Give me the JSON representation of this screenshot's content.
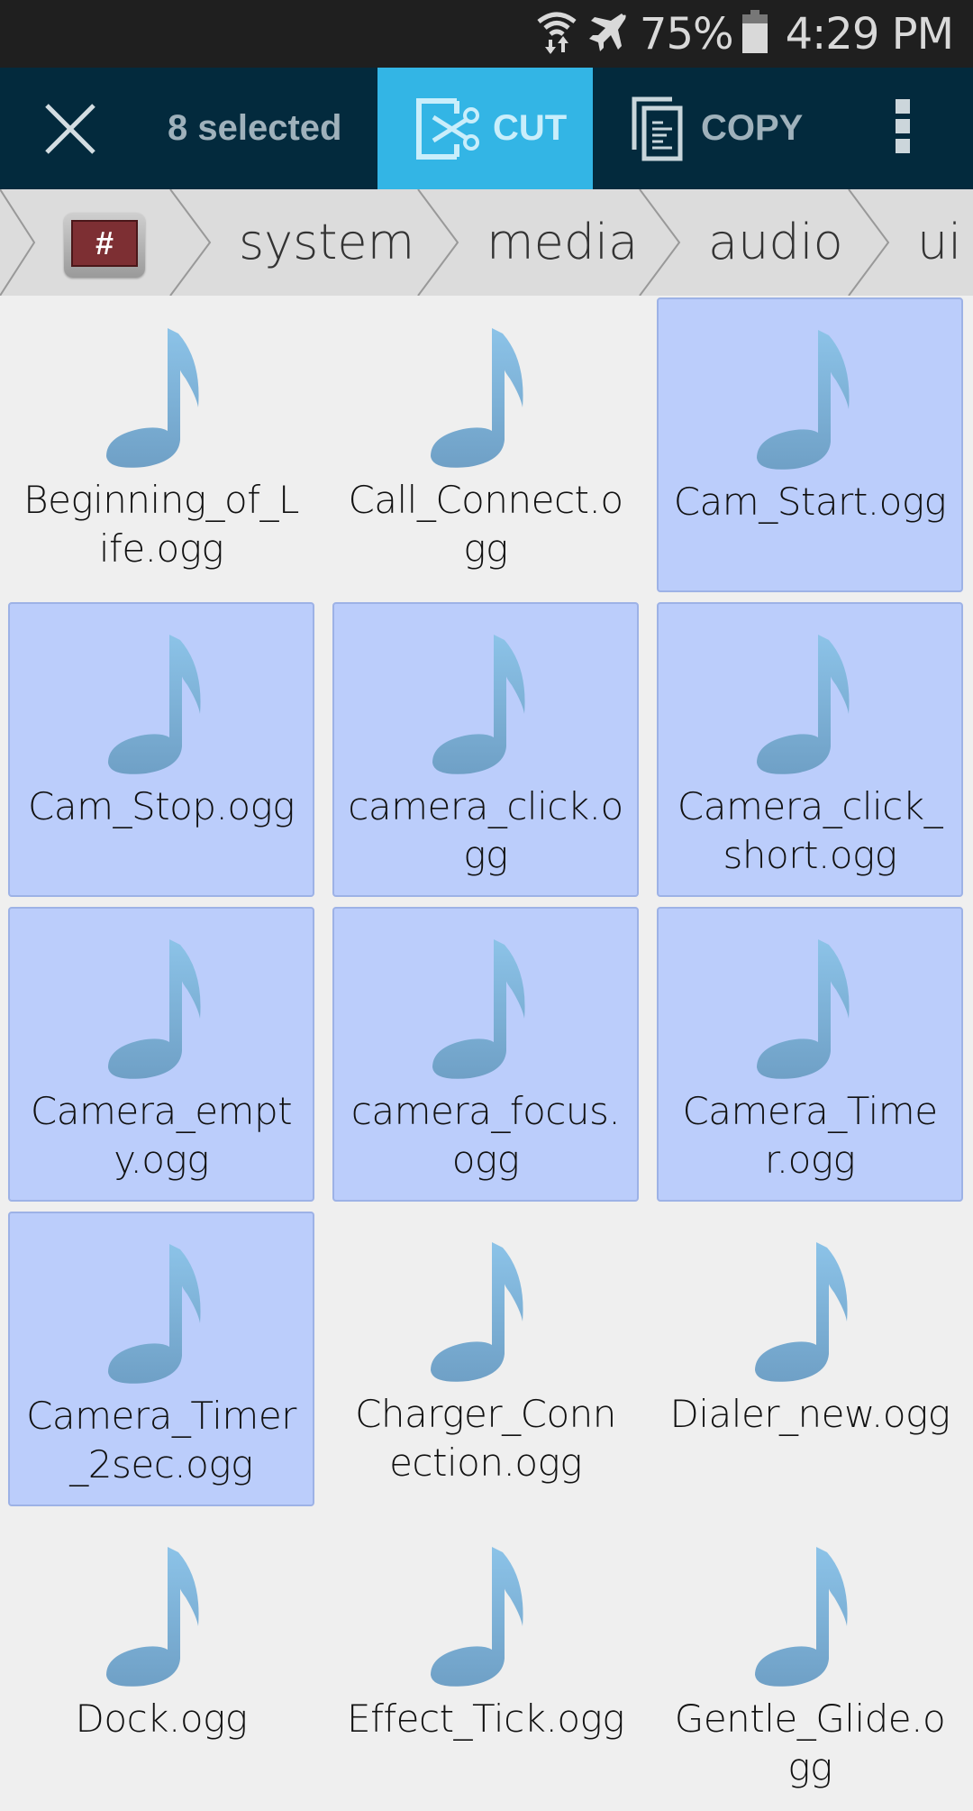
{
  "status_bar": {
    "icons": [
      "wifi-data-icon",
      "airplane-mode-icon",
      "battery-icon"
    ],
    "battery_percent": "75%",
    "time": "4:29 PM"
  },
  "action_bar": {
    "close_icon": "close-icon",
    "selected_count": "8 selected",
    "cut_label": "CUT",
    "copy_label": "COPY",
    "more_icon": "overflow-menu-icon",
    "accent_color": "#33b5e5",
    "background_color": "#032a3d"
  },
  "breadcrumb": {
    "root_label": "#",
    "items": [
      "system",
      "media",
      "audio",
      "ui"
    ]
  },
  "files": [
    {
      "name": "Beginning_of_Life.ogg",
      "selected": false
    },
    {
      "name": "Call_Connect.ogg",
      "selected": false
    },
    {
      "name": "Cam_Start.ogg",
      "selected": true
    },
    {
      "name": "Cam_Stop.ogg",
      "selected": true
    },
    {
      "name": "camera_click.ogg",
      "selected": true
    },
    {
      "name": "Camera_click_short.ogg",
      "selected": true
    },
    {
      "name": "Camera_empty.ogg",
      "selected": true
    },
    {
      "name": "camera_focus.ogg",
      "selected": true
    },
    {
      "name": "Camera_Timer.ogg",
      "selected": true
    },
    {
      "name": "Camera_Timer_2sec.ogg",
      "selected": true
    },
    {
      "name": "Charger_Connection.ogg",
      "selected": false
    },
    {
      "name": "Dialer_new.ogg",
      "selected": false
    },
    {
      "name": "Dock.ogg",
      "selected": false
    },
    {
      "name": "Effect_Tick.ogg",
      "selected": false
    },
    {
      "name": "Gentle_Glide.ogg",
      "selected": false
    }
  ],
  "colors": {
    "selection_fill": "#bbcdfb",
    "note_icon": "#7fb3dc"
  }
}
